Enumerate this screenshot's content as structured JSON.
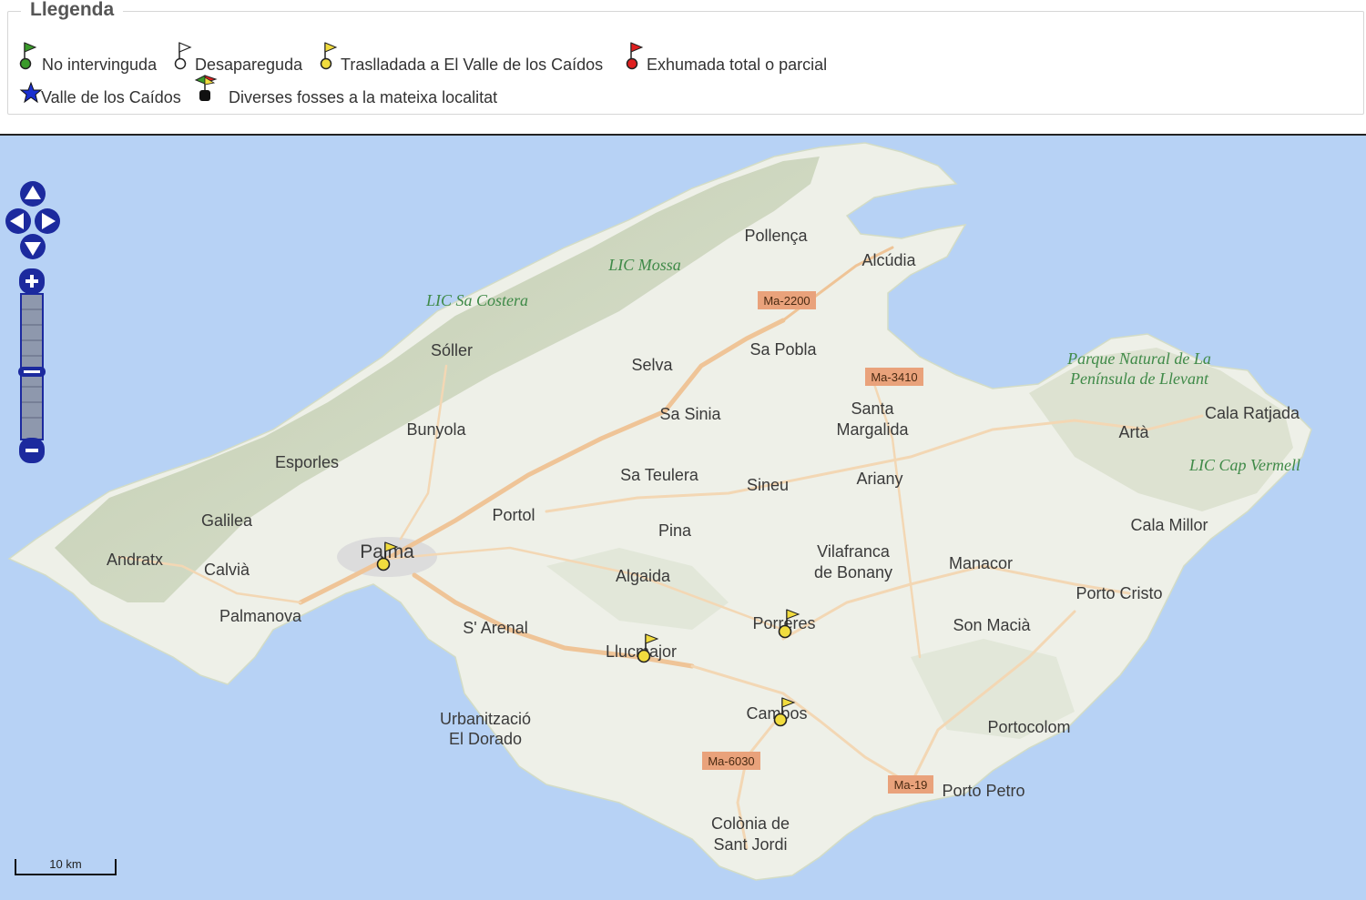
{
  "legend": {
    "title": "Llegenda",
    "items": [
      {
        "label": "No intervinguda",
        "color": "#3a9a2a"
      },
      {
        "label": "Desapareguda",
        "color": "#ffffff"
      },
      {
        "label": "Traslladada a El Valle de los Caídos",
        "color": "#f1dc3e"
      },
      {
        "label": "Exhumada total o parcial",
        "color": "#e02020"
      },
      {
        "label": "Valle de los Caídos",
        "color": "#1a2fd0"
      },
      {
        "label": "Diverses fosses a la mateixa localitat",
        "color": "#111111"
      }
    ]
  },
  "map": {
    "places": {
      "pollenca": "Pollença",
      "alcudia": "Alcúdia",
      "soller": "Sóller",
      "selva": "Selva",
      "sa_pobla": "Sa Pobla",
      "sa_sinia": "Sa Sinia",
      "santa_1": "Santa",
      "santa_2": "Margalida",
      "bunyola": "Bunyola",
      "esporles": "Esporles",
      "sa_teulera": "Sa Teulera",
      "sineu": "Sineu",
      "ariany": "Ariany",
      "arta": "Artà",
      "cala_ratjada": "Cala Ratjada",
      "cala_millor": "Cala Millor",
      "portol": "Portol",
      "pina": "Pina",
      "galilea": "Galilea",
      "andratx": "Andratx",
      "calvia": "Calvià",
      "palma": "Palma",
      "algaida": "Algaida",
      "vilafranca_1": "Vilafranca",
      "vilafranca_2": "de Bonany",
      "manacor": "Manacor",
      "porto_cristo": "Porto Cristo",
      "palmanova": "Palmanova",
      "s_arenal": "S' Arenal",
      "porreres": "Porreres",
      "son_macia": "Son Macià",
      "llucmajor": "Llucmajor",
      "campos": "Campos",
      "urb_1": "Urbanització",
      "urb_2": "El Dorado",
      "portocolom": "Portocolom",
      "porto_petro": "Porto Petro",
      "colonia_1": "Colònia de",
      "colonia_2": "Sant Jordi"
    },
    "parks": {
      "mossa": "LIC Mossa",
      "costera": "LIC Sa Costera",
      "llevant_1": "Parque Natural de La",
      "llevant_2": "Península de Llevant",
      "cap_vermell": "LIC Cap Vermell"
    },
    "roads": {
      "ma2200": "Ma-2200",
      "ma3410": "Ma-3410",
      "ma6030": "Ma-6030",
      "ma19": "Ma-19"
    },
    "scale_label": "10 km",
    "markers": [
      "Palma",
      "Llucmajor",
      "Porreres",
      "Campos"
    ]
  }
}
